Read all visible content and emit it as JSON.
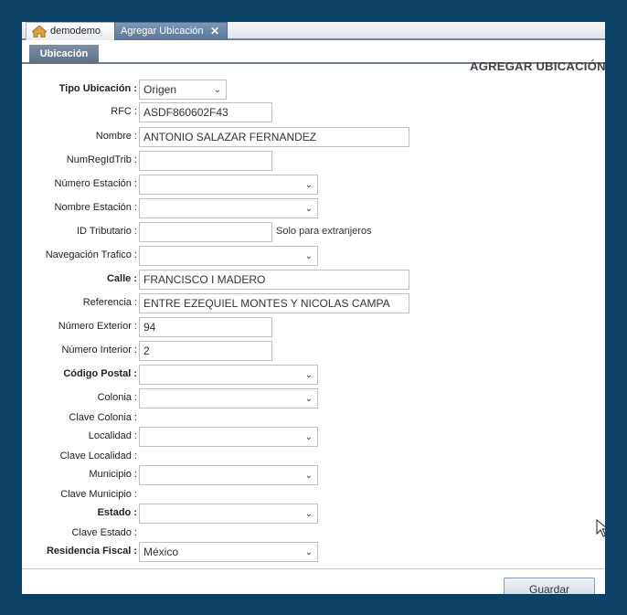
{
  "tabs": {
    "home_label": "demodemo",
    "active_label": "Agregar Ubicación",
    "close_glyph": "✕"
  },
  "subtab": {
    "label": "Ubicación"
  },
  "page_title": "AGREGAR UBICACIÓN",
  "form": {
    "tipo_ubicacion": {
      "label": "Tipo Ubicación :",
      "value": "Origen"
    },
    "rfc": {
      "label": "RFC :",
      "value": "ASDF860602F43"
    },
    "nombre": {
      "label": "Nombre :",
      "value": "ANTONIO SALAZAR FERNANDEZ"
    },
    "num_reg_id_trib": {
      "label": "NumRegIdTrib :",
      "value": ""
    },
    "numero_estacion": {
      "label": "Número Estación :",
      "value": ""
    },
    "nombre_estacion": {
      "label": "Nombre Estación :",
      "value": ""
    },
    "id_tributario": {
      "label": "ID Tributario :",
      "value": "",
      "note": "Solo para extranjeros"
    },
    "navegacion_trafico": {
      "label": "Navegación Trafico :",
      "value": ""
    },
    "calle": {
      "label": "Calle :",
      "value": "FRANCISCO I MADERO"
    },
    "referencia": {
      "label": "Referencia :",
      "value": "ENTRE EZEQUIEL MONTES Y NICOLAS CAMPA"
    },
    "numero_exterior": {
      "label": "Número Exterior :",
      "value": "94"
    },
    "numero_interior": {
      "label": "Número Interior :",
      "value": "2"
    },
    "codigo_postal": {
      "label": "Código Postal :",
      "value": ""
    },
    "colonia": {
      "label": "Colonia :",
      "value": ""
    },
    "clave_colonia": {
      "label": "Clave Colonia :"
    },
    "localidad": {
      "label": "Localidad :",
      "value": ""
    },
    "clave_localidad": {
      "label": "Clave Localidad :"
    },
    "municipio": {
      "label": "Municipio :",
      "value": ""
    },
    "clave_municipio": {
      "label": "Clave Municipio :"
    },
    "estado": {
      "label": "Estado :",
      "value": ""
    },
    "clave_estado": {
      "label": "Clave Estado :"
    },
    "residencia_fiscal": {
      "label": "Residencia Fiscal :",
      "value": "México"
    }
  },
  "buttons": {
    "save_label": "Guardar"
  },
  "icons": {
    "home": "home-icon",
    "dropdown": "chevron-down-icon",
    "cursor": "mouse-pointer-icon"
  },
  "colors": {
    "background": "#0b4166",
    "tab_active": "#6a84a6",
    "subtab": "#6d7f93"
  }
}
